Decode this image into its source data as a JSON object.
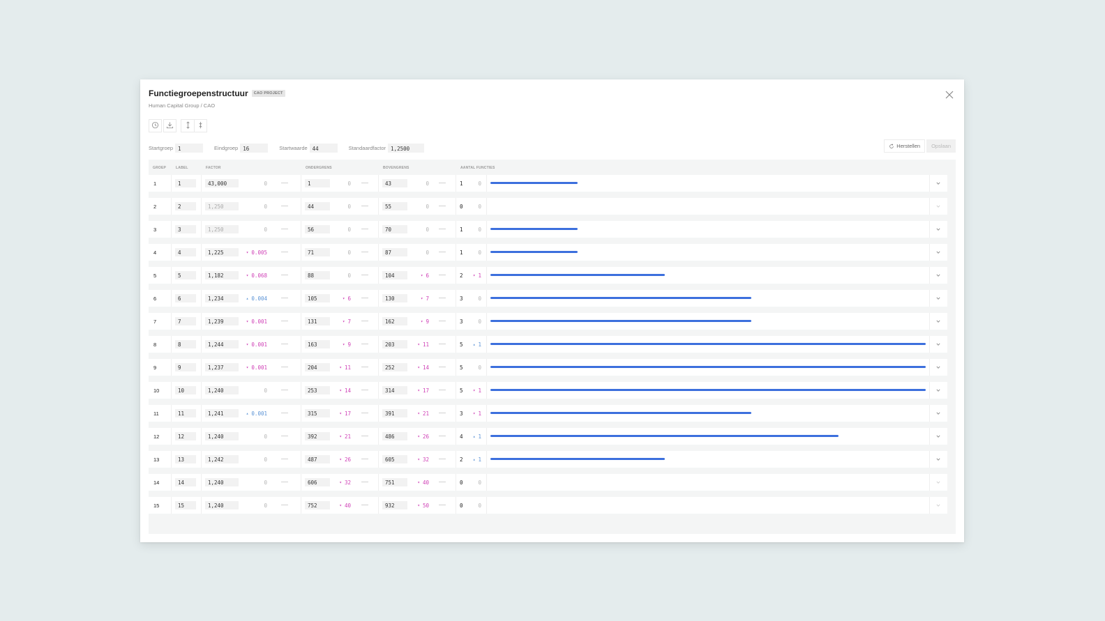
{
  "header": {
    "title": "Functiegroepenstructuur",
    "badge": "CAO PROJECT",
    "breadcrumb": "Human Capital Group / CAO"
  },
  "toolbar": {
    "buttons": [
      "history-icon",
      "download-icon",
      "sort-expand-icon",
      "sort-collapse-icon"
    ]
  },
  "params": {
    "startgroep_label": "Startgroep",
    "startgroep_value": "1",
    "eindgroep_label": "Eindgroep",
    "eindgroep_value": "16",
    "startwaarde_label": "Startwaarde",
    "startwaarde_value": "44",
    "standaardfactor_label": "Standaardfactor",
    "standaardfactor_value": "1,2500"
  },
  "actions": {
    "herstellen": "Herstellen",
    "opslaan": "Opslaan"
  },
  "columns": [
    "GROEP",
    "LABEL",
    "FACTOR",
    "ONDERGRENS",
    "BOVENGRENS",
    "AANTAL FUNCTIES"
  ],
  "colors": {
    "bar": "#3c6fdd",
    "decrease": "#cf3fb6",
    "increase": "#5b93d6"
  },
  "rows": [
    {
      "groep": "1",
      "label": "1",
      "factor": "43,000",
      "factor_muted": false,
      "factor_delta": "0",
      "factor_dir": "none",
      "onder": "1",
      "onder_delta": "0",
      "onder_dir": "none",
      "boven": "43",
      "boven_delta": "0",
      "boven_dir": "none",
      "aantal": "1",
      "aantal_delta": "0",
      "aantal_dir": "none",
      "bar_fraction": 0.2
    },
    {
      "groep": "2",
      "label": "2",
      "factor": "1,250",
      "factor_muted": true,
      "factor_delta": "0",
      "factor_dir": "none",
      "onder": "44",
      "onder_delta": "0",
      "onder_dir": "none",
      "boven": "55",
      "boven_delta": "0",
      "boven_dir": "none",
      "aantal": "0",
      "aantal_delta": "0",
      "aantal_dir": "none",
      "bar_fraction": 0
    },
    {
      "groep": "3",
      "label": "3",
      "factor": "1,250",
      "factor_muted": true,
      "factor_delta": "0",
      "factor_dir": "none",
      "onder": "56",
      "onder_delta": "0",
      "onder_dir": "none",
      "boven": "70",
      "boven_delta": "0",
      "boven_dir": "none",
      "aantal": "1",
      "aantal_delta": "0",
      "aantal_dir": "none",
      "bar_fraction": 0.2
    },
    {
      "groep": "4",
      "label": "4",
      "factor": "1,225",
      "factor_muted": false,
      "factor_delta": "0.005",
      "factor_dir": "down",
      "onder": "71",
      "onder_delta": "0",
      "onder_dir": "none",
      "boven": "87",
      "boven_delta": "0",
      "boven_dir": "none",
      "aantal": "1",
      "aantal_delta": "0",
      "aantal_dir": "none",
      "bar_fraction": 0.2
    },
    {
      "groep": "5",
      "label": "5",
      "factor": "1,182",
      "factor_muted": false,
      "factor_delta": "0.068",
      "factor_dir": "down",
      "onder": "88",
      "onder_delta": "0",
      "onder_dir": "none",
      "boven": "104",
      "boven_delta": "6",
      "boven_dir": "down",
      "aantal": "2",
      "aantal_delta": "1",
      "aantal_dir": "down",
      "bar_fraction": 0.4
    },
    {
      "groep": "6",
      "label": "6",
      "factor": "1,234",
      "factor_muted": false,
      "factor_delta": "0.004",
      "factor_dir": "up",
      "onder": "105",
      "onder_delta": "6",
      "onder_dir": "down",
      "boven": "130",
      "boven_delta": "7",
      "boven_dir": "down",
      "aantal": "3",
      "aantal_delta": "0",
      "aantal_dir": "none",
      "bar_fraction": 0.6
    },
    {
      "groep": "7",
      "label": "7",
      "factor": "1,239",
      "factor_muted": false,
      "factor_delta": "0.001",
      "factor_dir": "down",
      "onder": "131",
      "onder_delta": "7",
      "onder_dir": "down",
      "boven": "162",
      "boven_delta": "9",
      "boven_dir": "down",
      "aantal": "3",
      "aantal_delta": "0",
      "aantal_dir": "none",
      "bar_fraction": 0.6
    },
    {
      "groep": "8",
      "label": "8",
      "factor": "1,244",
      "factor_muted": false,
      "factor_delta": "0.001",
      "factor_dir": "down",
      "onder": "163",
      "onder_delta": "9",
      "onder_dir": "down",
      "boven": "203",
      "boven_delta": "11",
      "boven_dir": "down",
      "aantal": "5",
      "aantal_delta": "1",
      "aantal_dir": "up",
      "bar_fraction": 1.0
    },
    {
      "groep": "9",
      "label": "9",
      "factor": "1,237",
      "factor_muted": false,
      "factor_delta": "0.001",
      "factor_dir": "down",
      "onder": "204",
      "onder_delta": "11",
      "onder_dir": "down",
      "boven": "252",
      "boven_delta": "14",
      "boven_dir": "down",
      "aantal": "5",
      "aantal_delta": "0",
      "aantal_dir": "none",
      "bar_fraction": 1.0
    },
    {
      "groep": "10",
      "label": "10",
      "factor": "1,240",
      "factor_muted": false,
      "factor_delta": "0",
      "factor_dir": "none",
      "onder": "253",
      "onder_delta": "14",
      "onder_dir": "down",
      "boven": "314",
      "boven_delta": "17",
      "boven_dir": "down",
      "aantal": "5",
      "aantal_delta": "1",
      "aantal_dir": "down",
      "bar_fraction": 1.0
    },
    {
      "groep": "11",
      "label": "11",
      "factor": "1,241",
      "factor_muted": false,
      "factor_delta": "0.001",
      "factor_dir": "up",
      "onder": "315",
      "onder_delta": "17",
      "onder_dir": "down",
      "boven": "391",
      "boven_delta": "21",
      "boven_dir": "down",
      "aantal": "3",
      "aantal_delta": "1",
      "aantal_dir": "down",
      "bar_fraction": 0.6
    },
    {
      "groep": "12",
      "label": "12",
      "factor": "1,240",
      "factor_muted": false,
      "factor_delta": "0",
      "factor_dir": "none",
      "onder": "392",
      "onder_delta": "21",
      "onder_dir": "down",
      "boven": "486",
      "boven_delta": "26",
      "boven_dir": "down",
      "aantal": "4",
      "aantal_delta": "1",
      "aantal_dir": "up",
      "bar_fraction": 0.8
    },
    {
      "groep": "13",
      "label": "13",
      "factor": "1,242",
      "factor_muted": false,
      "factor_delta": "0",
      "factor_dir": "none",
      "onder": "487",
      "onder_delta": "26",
      "onder_dir": "down",
      "boven": "605",
      "boven_delta": "32",
      "boven_dir": "down",
      "aantal": "2",
      "aantal_delta": "1",
      "aantal_dir": "up",
      "bar_fraction": 0.4
    },
    {
      "groep": "14",
      "label": "14",
      "factor": "1,240",
      "factor_muted": false,
      "factor_delta": "0",
      "factor_dir": "none",
      "onder": "606",
      "onder_delta": "32",
      "onder_dir": "down",
      "boven": "751",
      "boven_delta": "40",
      "boven_dir": "down",
      "aantal": "0",
      "aantal_delta": "0",
      "aantal_dir": "none",
      "bar_fraction": 0
    },
    {
      "groep": "15",
      "label": "15",
      "factor": "1,240",
      "factor_muted": false,
      "factor_delta": "0",
      "factor_dir": "none",
      "onder": "752",
      "onder_delta": "40",
      "onder_dir": "down",
      "boven": "932",
      "boven_delta": "50",
      "boven_dir": "down",
      "aantal": "0",
      "aantal_delta": "0",
      "aantal_dir": "none",
      "bar_fraction": 0
    }
  ]
}
